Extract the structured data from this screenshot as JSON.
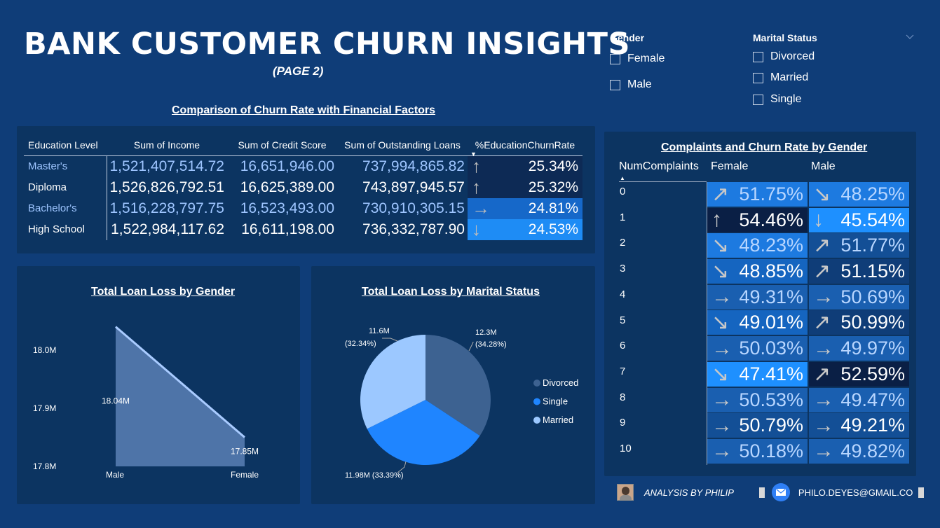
{
  "header": {
    "title": "BANK CUSTOMER CHURN INSIGHTS",
    "subtitle": "(PAGE 2)"
  },
  "slicers": {
    "gender": {
      "label": "Gender",
      "options": [
        "Female",
        "Male"
      ]
    },
    "marital": {
      "label": "Marital Status",
      "options": [
        "Divorced",
        "Married",
        "Single"
      ]
    }
  },
  "financial_table": {
    "title": "Comparison of Churn Rate with Financial Factors",
    "columns": [
      "Education Level",
      "Sum of Income",
      "Sum of Credit Score",
      "Sum of Outstanding Loans",
      "%EducationChurnRate"
    ],
    "rows": [
      {
        "level": "Master's",
        "income": "1,521,407,514.72",
        "credit": "16,651,946.00",
        "loans": "737,994,865.82",
        "rate": "25.34%",
        "arrow": "↑",
        "bg": "#0d2a55"
      },
      {
        "level": "Diploma",
        "income": "1,526,826,792.51",
        "credit": "16,625,389.00",
        "loans": "743,897,945.57",
        "rate": "25.32%",
        "arrow": "↑",
        "bg": "#0d2a55"
      },
      {
        "level": "Bachelor's",
        "income": "1,516,228,797.75",
        "credit": "16,523,493.00",
        "loans": "730,910,305.15",
        "rate": "24.81%",
        "arrow": "→",
        "bg": "#1668c9"
      },
      {
        "level": "High School",
        "income": "1,522,984,117.62",
        "credit": "16,611,198.00",
        "loans": "736,332,787.90",
        "rate": "24.53%",
        "arrow": "↓",
        "bg": "#1e8cf5"
      }
    ]
  },
  "complaints": {
    "title": "Complaints and Churn Rate by Gender",
    "headers": [
      "NumComplaints",
      "Female",
      "Male"
    ],
    "rows": [
      {
        "n": "0",
        "f": "51.75%",
        "fa": "↗",
        "fbg": "#1d7ae0",
        "fc": "#b8d6ff",
        "m": "48.25%",
        "ma": "↘",
        "mbg": "#1d7ae0",
        "mc": "#b8d6ff"
      },
      {
        "n": "1",
        "f": "54.46%",
        "fa": "↑",
        "fbg": "#0a1f45",
        "fc": "#ffffff",
        "m": "45.54%",
        "ma": "↓",
        "mbg": "#1e90ff",
        "mc": "#ffffff"
      },
      {
        "n": "2",
        "f": "48.23%",
        "fa": "↘",
        "fbg": "#1d7ae0",
        "fc": "#b8d6ff",
        "m": "51.77%",
        "ma": "↗",
        "mbg": "#134f96",
        "mc": "#b8d6ff"
      },
      {
        "n": "3",
        "f": "48.85%",
        "fa": "↘",
        "fbg": "#1565c0",
        "fc": "#ffffff",
        "m": "51.15%",
        "ma": "↗",
        "mbg": "#0f3d78",
        "mc": "#ffffff"
      },
      {
        "n": "4",
        "f": "49.31%",
        "fa": "→",
        "fbg": "#1a5fb0",
        "fc": "#b8d6ff",
        "m": "50.69%",
        "ma": "→",
        "mbg": "#1a5fb0",
        "mc": "#b8d6ff"
      },
      {
        "n": "5",
        "f": "49.01%",
        "fa": "↘",
        "fbg": "#1565c0",
        "fc": "#ffffff",
        "m": "50.99%",
        "ma": "↗",
        "mbg": "#0f3d78",
        "mc": "#ffffff"
      },
      {
        "n": "6",
        "f": "50.03%",
        "fa": "→",
        "fbg": "#1a5fb0",
        "fc": "#b8d6ff",
        "m": "49.97%",
        "ma": "→",
        "mbg": "#1a5fb0",
        "mc": "#b8d6ff"
      },
      {
        "n": "7",
        "f": "47.41%",
        "fa": "↘",
        "fbg": "#1e90ff",
        "fc": "#ffffff",
        "m": "52.59%",
        "ma": "↗",
        "mbg": "#0a1f45",
        "mc": "#ffffff"
      },
      {
        "n": "8",
        "f": "50.53%",
        "fa": "→",
        "fbg": "#1a5fb0",
        "fc": "#b8d6ff",
        "m": "49.47%",
        "ma": "→",
        "mbg": "#1a5fb0",
        "mc": "#b8d6ff"
      },
      {
        "n": "9",
        "f": "50.79%",
        "fa": "→",
        "fbg": "#134f96",
        "fc": "#ffffff",
        "m": "49.21%",
        "ma": "→",
        "mbg": "#134f96",
        "mc": "#ffffff"
      },
      {
        "n": "10",
        "f": "50.18%",
        "fa": "→",
        "fbg": "#1a5fb0",
        "fc": "#b8d6ff",
        "m": "49.82%",
        "ma": "→",
        "mbg": "#1a5fb0",
        "mc": "#b8d6ff"
      }
    ]
  },
  "chart_data": [
    {
      "type": "area",
      "title": "Total Loan Loss by Gender",
      "categories": [
        "Male",
        "Female"
      ],
      "values": [
        18.04,
        17.85
      ],
      "data_labels": [
        "18.04M",
        "17.85M"
      ],
      "ytick_labels": [
        "18.0M",
        "17.9M",
        "17.8M"
      ],
      "yticks": [
        18.0,
        17.9,
        17.8
      ],
      "ylim": [
        17.8,
        18.06
      ],
      "color": "#4e74a8"
    },
    {
      "type": "pie",
      "title": "Total Loan Loss by Marital Status",
      "slices": [
        {
          "label": "Divorced",
          "value": 12.3,
          "pct": 34.28,
          "text1": "12.3M",
          "text2": "(34.28%)",
          "color": "#3d6291"
        },
        {
          "label": "Single",
          "value": 11.98,
          "pct": 33.39,
          "text1": "11.98M (33.39%)",
          "text2": "",
          "color": "#1f85ff"
        },
        {
          "label": "Married",
          "value": 11.6,
          "pct": 32.34,
          "text1": "11.6M",
          "text2": "(32.34%)",
          "color": "#9cc8ff"
        }
      ],
      "legend": [
        "Divorced",
        "Single",
        "Married"
      ]
    }
  ],
  "footer": {
    "author": "ANALYSIS BY PHILIP",
    "email": "PHILO.DEYES@GMAIL.CO"
  }
}
